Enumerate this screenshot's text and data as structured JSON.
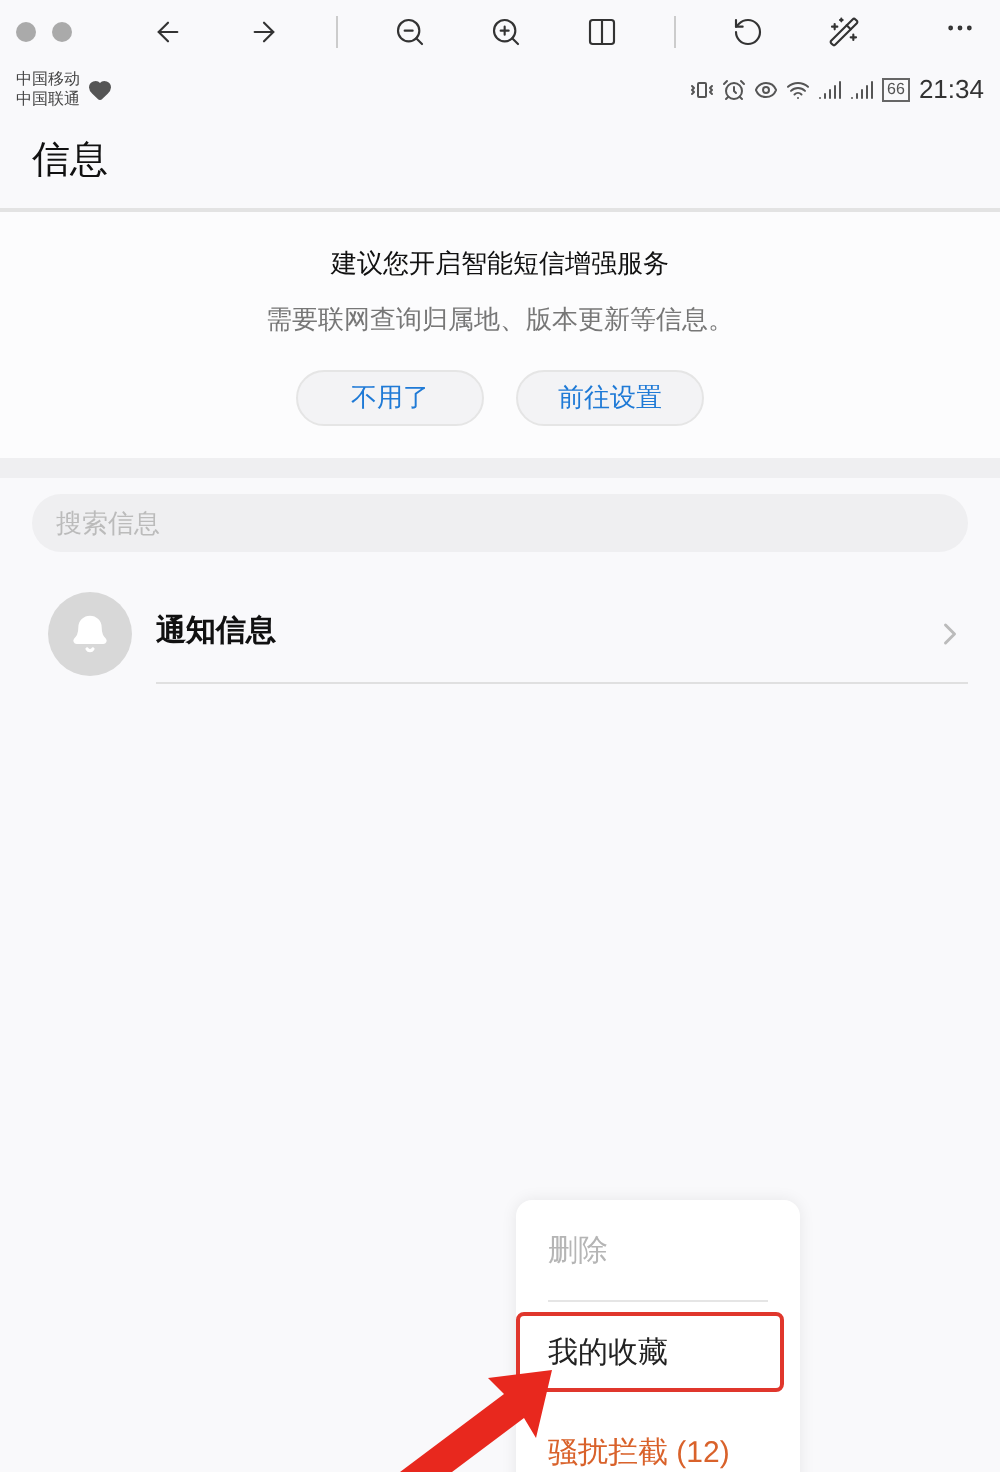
{
  "status_bar": {
    "carriers": [
      "中国移动",
      "中国联通"
    ],
    "battery": "66",
    "time": "21:34"
  },
  "title": "信息",
  "banner": {
    "heading": "建议您开启智能短信增强服务",
    "text": "需要联网查询归属地、版本更新等信息。",
    "buttons": [
      "不用了",
      "前往设置"
    ]
  },
  "search": {
    "placeholder": "搜索信息"
  },
  "conversations": [
    {
      "name": "通知信息"
    }
  ],
  "menu": [
    {
      "label": "删除",
      "kind": "disabled",
      "highlighted": false
    },
    {
      "label": "我的收藏",
      "kind": "normal",
      "highlighted": true
    },
    {
      "label": "骚扰拦截 (12)",
      "kind": "warning",
      "highlighted": false
    }
  ]
}
